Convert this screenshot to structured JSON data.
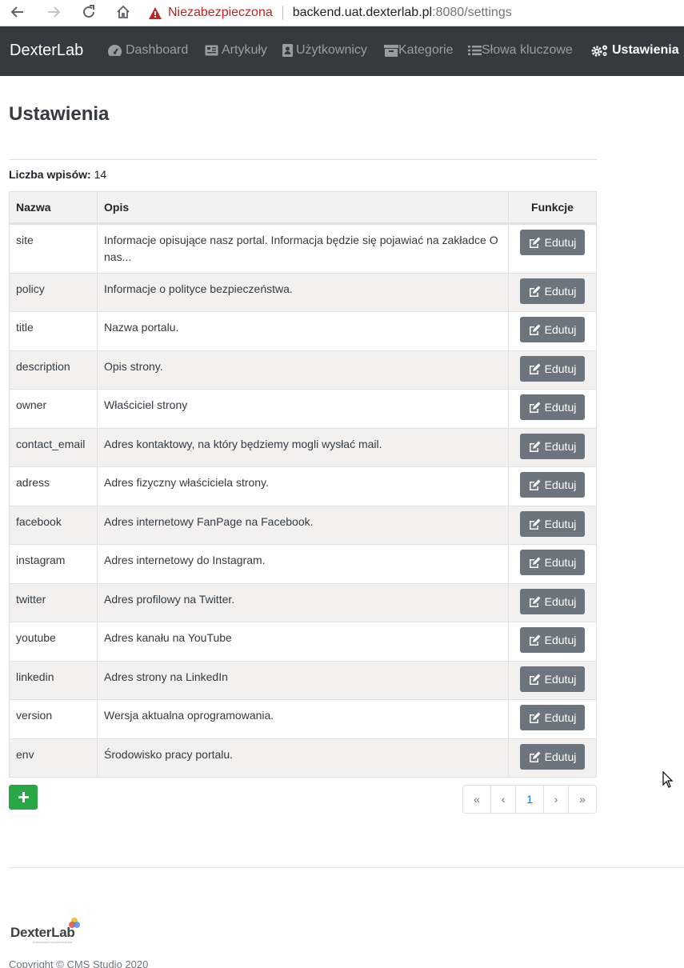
{
  "browser": {
    "security_label": "Niezabezpieczona",
    "url_host": "backend.uat.dexterlab.pl",
    "url_rest": ":8080/settings"
  },
  "navbar": {
    "brand": "DexterLab",
    "items": [
      {
        "label": "Dashboard",
        "icon": "tachometer-icon"
      },
      {
        "label": "Artykuły",
        "icon": "newspaper-icon"
      },
      {
        "label": "Użytkownicy",
        "icon": "user-card-icon"
      },
      {
        "label": "Kategorie",
        "icon": "archive-icon"
      },
      {
        "label": "Słowa kluczowe",
        "icon": "list-icon"
      },
      {
        "label": "Ustawienia",
        "icon": "cogs-icon",
        "active": true
      }
    ]
  },
  "page": {
    "title": "Ustawienia",
    "count_label": "Liczba wpisów:",
    "count_value": "14"
  },
  "table": {
    "headers": {
      "name": "Nazwa",
      "desc": "Opis",
      "functions": "Funkcje"
    },
    "edit_label": "Edutuj",
    "rows": [
      {
        "name": "site",
        "desc": "Informacje opisujące nasz portal. Informacja będzie się pojawiać na zakładce O nas..."
      },
      {
        "name": "policy",
        "desc": "Informacje o polityce bezpieczeństwa."
      },
      {
        "name": "title",
        "desc": "Nazwa portalu."
      },
      {
        "name": "description",
        "desc": "Opis strony."
      },
      {
        "name": "owner",
        "desc": "Właściciel strony"
      },
      {
        "name": "contact_email",
        "desc": "Adres kontaktowy, na który będziemy mogli wysłać mail."
      },
      {
        "name": "adress",
        "desc": "Adres fizyczny właściciela strony."
      },
      {
        "name": "facebook",
        "desc": "Adres internetowy FanPage na Facebook."
      },
      {
        "name": "instagram",
        "desc": "Adres internetowy do Instagram."
      },
      {
        "name": "twitter",
        "desc": "Adres profilowy na Twitter."
      },
      {
        "name": "youtube",
        "desc": "Adres kanału na YouTube"
      },
      {
        "name": "linkedin",
        "desc": "Adres strony na LinkedIn"
      },
      {
        "name": "version",
        "desc": "Wersja aktualna oprogramowania."
      },
      {
        "name": "env",
        "desc": "Środowisko pracy portalu."
      }
    ]
  },
  "pagination": {
    "first": "«",
    "prev": "‹",
    "current": "1",
    "next": "›",
    "last": "»"
  },
  "footer": {
    "logo_text": "DexterLab",
    "logo_sub": "ROZWIĄZANIA TECHNOLOGICZNE",
    "copyright": "Copyright © CMS Studio 2020"
  },
  "colors": {
    "navbar": "#343a40",
    "edit_button": "#6c757d",
    "add_button": "#28a745",
    "link": "#007bff",
    "warning": "#c5221f"
  }
}
